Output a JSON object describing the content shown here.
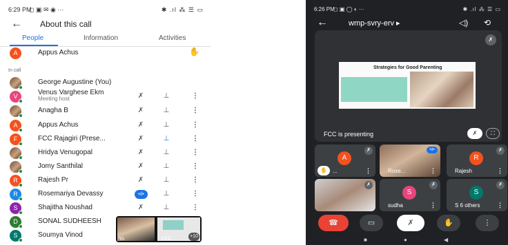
{
  "left": {
    "status": {
      "time": "6:29 PM",
      "notifs": "◻ ▣ ✉ ◉  ···",
      "right_icons": "✱ .ıl ⁂ ☰ ▭"
    },
    "appbar": {
      "back": "←",
      "title": "About this call"
    },
    "tabs": [
      {
        "label": "People",
        "active": true
      },
      {
        "label": "Information",
        "active": false
      },
      {
        "label": "Activities",
        "active": false
      }
    ],
    "lobby": {
      "initial": "A",
      "name": "Appus Achus",
      "hand": "✋"
    },
    "in_call_label": "In call",
    "participants": [
      {
        "initial": "",
        "photo": true,
        "color": "",
        "name": "George Augustine (You)",
        "sub": "",
        "icons": false
      },
      {
        "initial": "V",
        "photo": false,
        "color": "#e8467c",
        "name": "Venus Varghese Ekm",
        "sub": "Meeting host",
        "icons": true
      },
      {
        "initial": "",
        "photo": true,
        "color": "",
        "name": "Anagha B",
        "sub": "",
        "icons": true
      },
      {
        "initial": "A",
        "photo": false,
        "color": "#f4511e",
        "name": "Appus Achus",
        "sub": "",
        "icons": true
      },
      {
        "initial": "F",
        "photo": false,
        "color": "#f4511e",
        "name": "FCC Rajagiri (Prese...",
        "sub": "",
        "icons": true,
        "pin_active": true
      },
      {
        "initial": "",
        "photo": true,
        "color": "",
        "name": "Hridya Venugopal",
        "sub": "",
        "icons": true
      },
      {
        "initial": "",
        "photo": true,
        "color": "",
        "name": "Jomy Santhilal",
        "sub": "",
        "icons": true
      },
      {
        "initial": "R",
        "photo": false,
        "color": "#f4511e",
        "name": "Rajesh Pr",
        "sub": "",
        "icons": true
      },
      {
        "initial": "R",
        "photo": false,
        "color": "#1e88e5",
        "name": "Rosemariya Devassy",
        "sub": "",
        "icons": true,
        "speaking": true
      },
      {
        "initial": "S",
        "photo": false,
        "color": "#8e24aa",
        "name": "Shajitha Noushad",
        "sub": "",
        "icons": true
      },
      {
        "initial": "D",
        "photo": false,
        "color": "#2e7d32",
        "name": "SONAL SUDHEESH",
        "sub": "",
        "icons": false
      },
      {
        "initial": "S",
        "photo": false,
        "color": "#00796b",
        "name": "Soumya Vinod",
        "sub": "",
        "icons": false
      }
    ],
    "icon_glyphs": {
      "mic_off": "✗",
      "pin": "⊥",
      "more": "⋮",
      "speaking": "•ıl•"
    },
    "pip": {
      "label_a": "Yo",
      "label_b": "FCC",
      "more_count": "+10"
    }
  },
  "right": {
    "status": {
      "time": "6:26 PM",
      "notifs": "◻ ▣ ◯ ◐  ···",
      "right_icons": "✱ .ıl ⁂ ☰ ▭"
    },
    "appbar": {
      "back": "←",
      "meeting_code": "wmp-svry-erv ▸",
      "speaker": "◁)",
      "camera_switch": "⟲"
    },
    "presentation": {
      "slide_title": "Strategies for Good Parenting",
      "presenting_label": "FCC is presenting",
      "mute_glyph": "✗",
      "fullscreen_glyph": "⛶"
    },
    "tiles": [
      {
        "name": "...",
        "initial": "A",
        "color": "#f4511e",
        "hand": true
      },
      {
        "name": "Rose...",
        "initial": "",
        "video": true,
        "speaking": true
      },
      {
        "name": "Rajesh",
        "initial": "R",
        "color": "#f4511e"
      },
      {
        "name": "",
        "initial": "",
        "video": true,
        "video_alt": true
      },
      {
        "name": "sudha",
        "initial": "S",
        "color": "#e8467c"
      },
      {
        "name": "S   6 others",
        "initial": "S",
        "color": "#00796b"
      }
    ],
    "controls": {
      "end": "☎",
      "camera": "▭",
      "mic": "✗",
      "hand": "✋",
      "more": "⋮"
    },
    "nav": {
      "back": "◀",
      "home": "●",
      "recents": "■"
    }
  }
}
